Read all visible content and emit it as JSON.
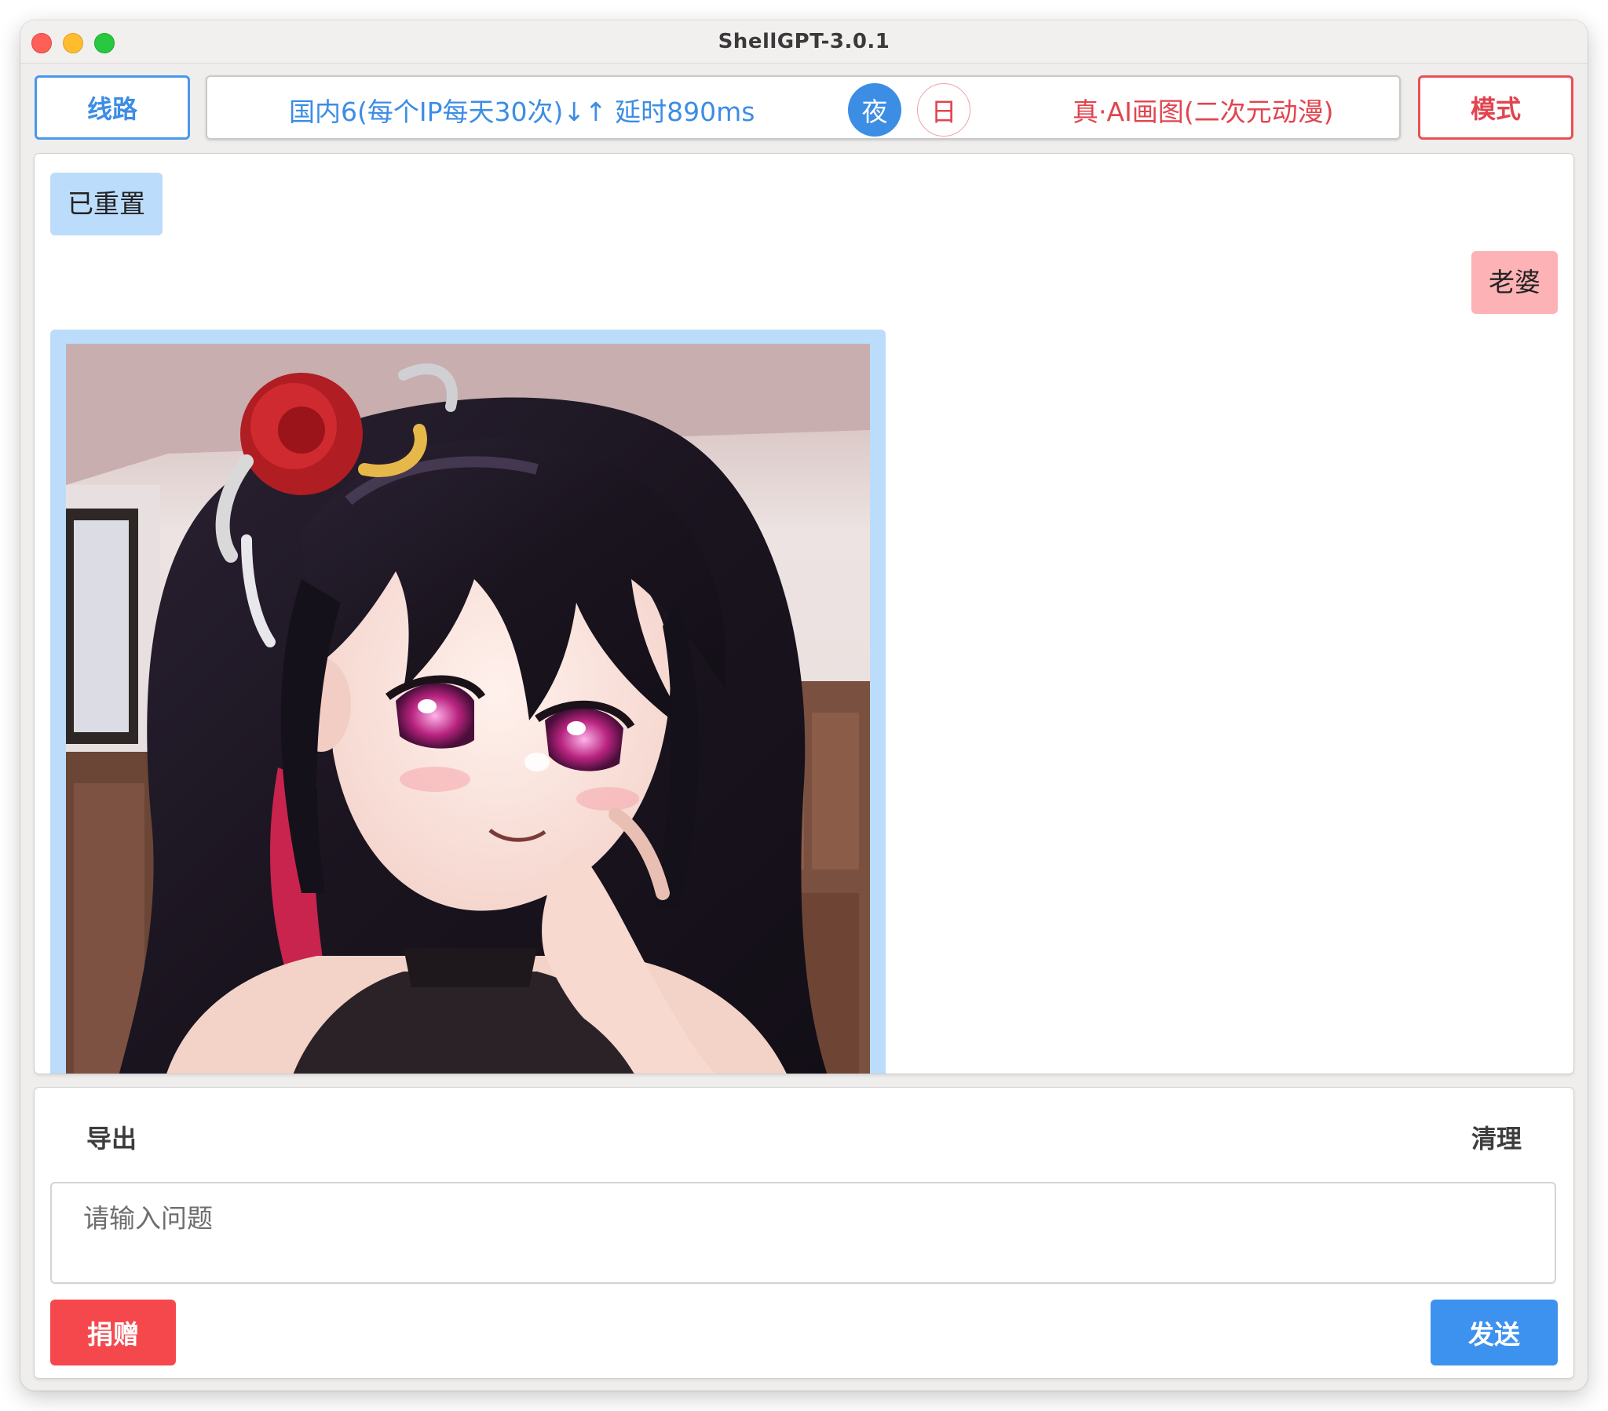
{
  "window": {
    "title": "ShellGPT-3.0.1"
  },
  "toolbar": {
    "route_button": "线路",
    "route_info": "国内6(每个IP每天30次)↓↑ 延时890ms",
    "night_button": "夜",
    "day_button": "日",
    "mode_info": "真·AI画图(二次元动漫)",
    "mode_button": "模式"
  },
  "chat": {
    "messages": [
      {
        "role": "system",
        "text": "已重置"
      },
      {
        "role": "user",
        "text": "老婆"
      },
      {
        "role": "assistant",
        "type": "image",
        "subject": "anime-girl-illustration"
      }
    ]
  },
  "panel": {
    "export_label": "导出",
    "clear_label": "清理",
    "input_placeholder": "请输入问题",
    "input_value": "",
    "donate_button": "捐赠",
    "send_button": "发送"
  },
  "colors": {
    "accent_blue": "#3c8de4",
    "accent_red": "#e14550",
    "system_bubble": "#bcdcfc",
    "user_bubble": "#fdb2b5",
    "donate_bg": "#f5484d",
    "send_bg": "#3e92ef"
  }
}
